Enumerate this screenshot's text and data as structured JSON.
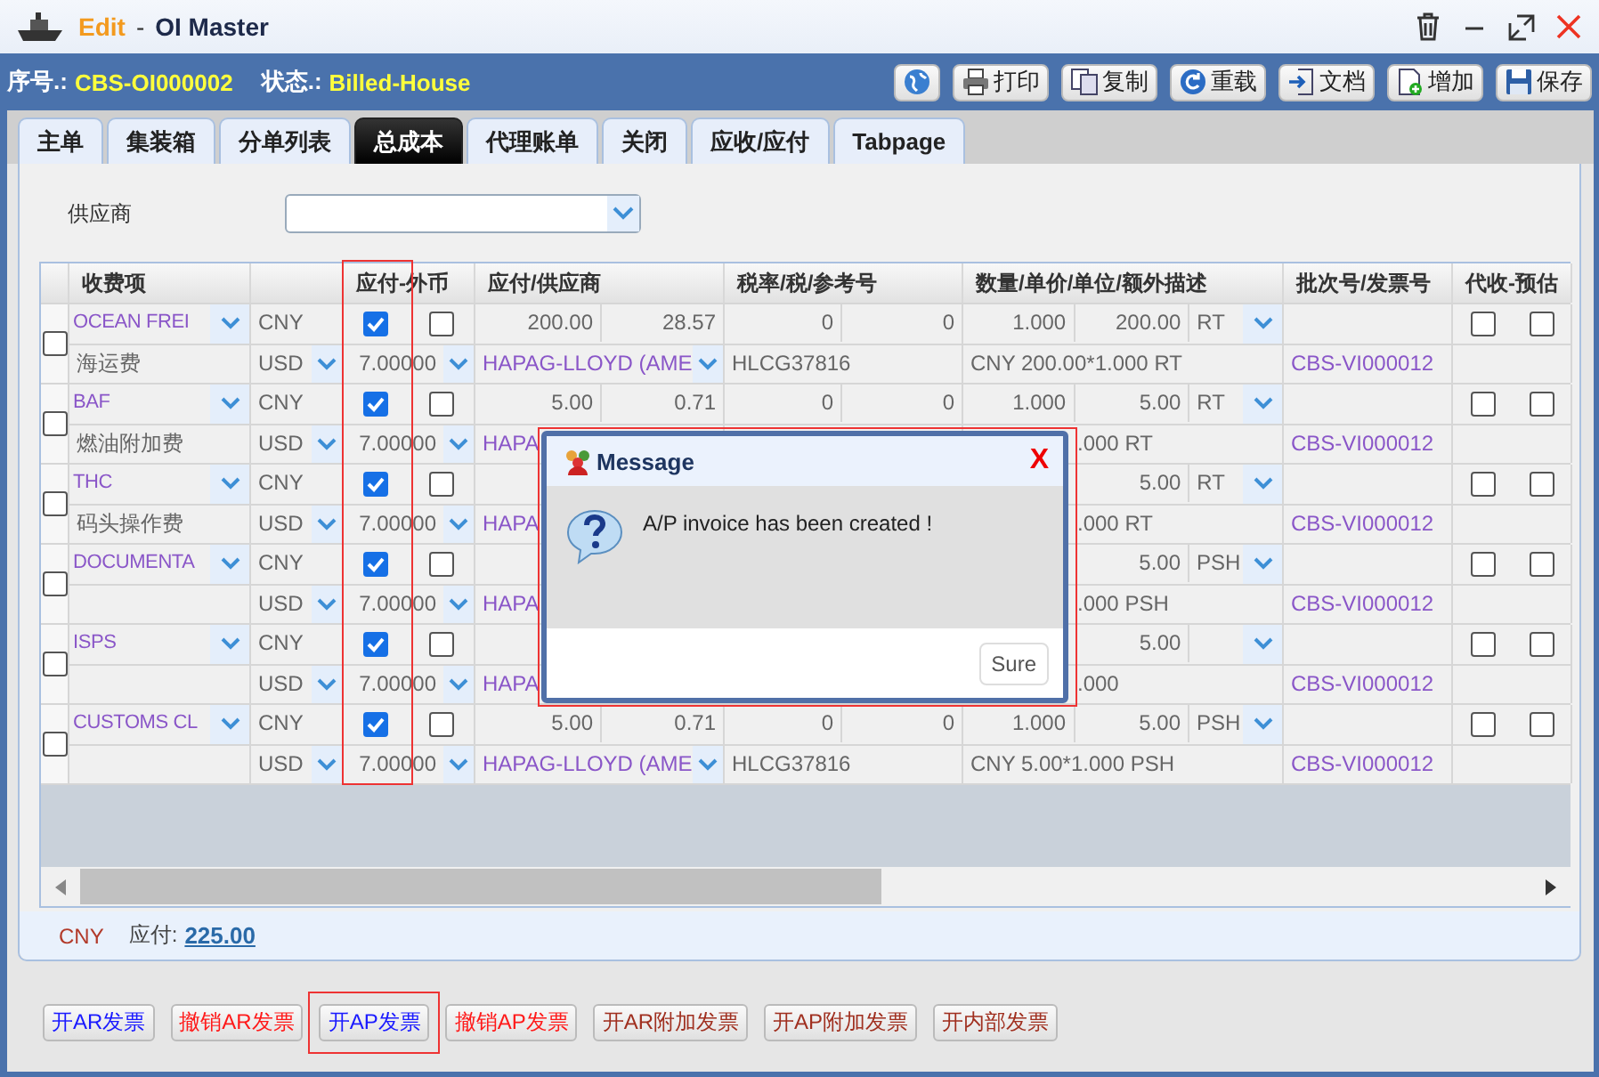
{
  "window": {
    "mode": "Edit",
    "separator": "-",
    "title": "OI Master"
  },
  "header": {
    "serial_label": "序号.:",
    "serial": "CBS-OI000002",
    "status_label": "状态.:",
    "status": "Billed-House"
  },
  "toolbar": [
    {
      "kind": "globe"
    },
    {
      "kind": "print",
      "label": "打印"
    },
    {
      "kind": "copy",
      "label": "复制"
    },
    {
      "kind": "reload",
      "label": "重载"
    },
    {
      "kind": "doc",
      "label": "文档"
    },
    {
      "kind": "add",
      "label": "增加"
    },
    {
      "kind": "save",
      "label": "保存"
    }
  ],
  "tabs": [
    {
      "label": "主单",
      "selected": false
    },
    {
      "label": "集装箱",
      "selected": false
    },
    {
      "label": "分单列表",
      "selected": false
    },
    {
      "label": "总成本",
      "selected": true
    },
    {
      "label": "代理账单",
      "selected": false
    },
    {
      "label": "关闭",
      "selected": false
    },
    {
      "label": "应收/应付",
      "selected": false
    },
    {
      "label": "Tabpage",
      "selected": false
    }
  ],
  "supplier": {
    "label": "供应商"
  },
  "table": {
    "columns": [
      "收费项",
      "应付-外币",
      "应付/供应商",
      "税率/税/参考号",
      "数量/单价/单位/额外描述",
      "批次号/发票号",
      "代收-预估"
    ],
    "pay_column_highlighted": true,
    "records": [
      {
        "selected": false,
        "name": "OCEAN FREI",
        "currency": "CNY",
        "pay": true,
        "foreign": false,
        "amount": "200.00",
        "amount2": "28.57",
        "tax": "0",
        "tax2": "0",
        "qty": "1.000",
        "price": "200.00",
        "unit": "RT",
        "collect": false,
        "estimate": false,
        "subname": "海运费",
        "fx_currency": "USD",
        "rate": "7.00000",
        "supplier": "HAPAG-LLOYD (AME",
        "ref": "HLCG37816",
        "desc": "CNY 200.00*1.000 RT",
        "invoice": "CBS-VI000012",
        "covered": false
      },
      {
        "selected": false,
        "name": "BAF",
        "currency": "CNY",
        "pay": true,
        "foreign": false,
        "amount": "5.00",
        "amount2": "0.71",
        "tax": "0",
        "tax2": "0",
        "qty": "1.000",
        "price": "5.00",
        "unit": "RT",
        "collect": false,
        "estimate": false,
        "subname": "燃油附加费",
        "fx_currency": "USD",
        "rate": "7.00000",
        "supplier": "HAPA",
        "desc": ".000 RT",
        "invoice": "CBS-VI000012",
        "covered": true
      },
      {
        "selected": false,
        "name": "THC",
        "currency": "CNY",
        "pay": true,
        "foreign": false,
        "price": "5.00",
        "unit": "RT",
        "collect": false,
        "estimate": false,
        "subname": "码头操作费",
        "fx_currency": "USD",
        "rate": "7.00000",
        "supplier": "HAPA",
        "desc": ".000 RT",
        "invoice": "CBS-VI000012",
        "covered": true
      },
      {
        "selected": false,
        "name": "DOCUMENTA",
        "currency": "CNY",
        "pay": true,
        "foreign": false,
        "price": "5.00",
        "unit": "PSH",
        "collect": false,
        "estimate": false,
        "fx_currency": "USD",
        "rate": "7.00000",
        "supplier": "HAPA",
        "desc": ".000 PSH",
        "invoice": "CBS-VI000012",
        "covered": true
      },
      {
        "selected": false,
        "name": "ISPS",
        "currency": "CNY",
        "pay": true,
        "foreign": false,
        "price": "5.00",
        "collect": false,
        "estimate": false,
        "fx_currency": "USD",
        "rate": "7.00000",
        "supplier": "HAPA",
        "desc": ".000",
        "invoice": "CBS-VI000012",
        "covered": true
      },
      {
        "selected": false,
        "name": "CUSTOMS CL",
        "currency": "CNY",
        "pay": true,
        "foreign": false,
        "amount": "5.00",
        "amount2": "0.71",
        "tax": "0",
        "tax2": "0",
        "qty": "1.000",
        "price": "5.00",
        "unit": "PSH",
        "collect": false,
        "estimate": false,
        "fx_currency": "USD",
        "rate": "7.00000",
        "supplier": "HAPAG-LLOYD (AME",
        "ref": "HLCG37816",
        "desc": "CNY 5.00*1.000 PSH",
        "invoice": "CBS-VI000012",
        "covered": false
      }
    ]
  },
  "totals": {
    "currency": "CNY",
    "label": "应付:",
    "amount": "225.00"
  },
  "actions": [
    {
      "label": "开AR发票",
      "color": "#1a1aff",
      "highlighted": false
    },
    {
      "label": "撤销AR发票",
      "color": "#ff1a1a",
      "highlighted": false
    },
    {
      "label": "开AP发票",
      "color": "#1a1aff",
      "highlighted": true
    },
    {
      "label": "撤销AP发票",
      "color": "#ff1a1a",
      "highlighted": false
    },
    {
      "label": "开AR附加发票",
      "color": "#a03020",
      "highlighted": false
    },
    {
      "label": "开AP附加发票",
      "color": "#a03020",
      "highlighted": false
    },
    {
      "label": "开内部发票",
      "color": "#a03020",
      "highlighted": false
    }
  ],
  "dialog": {
    "title": "Message",
    "close": "X",
    "message": "A/P invoice has been created !",
    "button": "Sure",
    "highlighted": true
  }
}
